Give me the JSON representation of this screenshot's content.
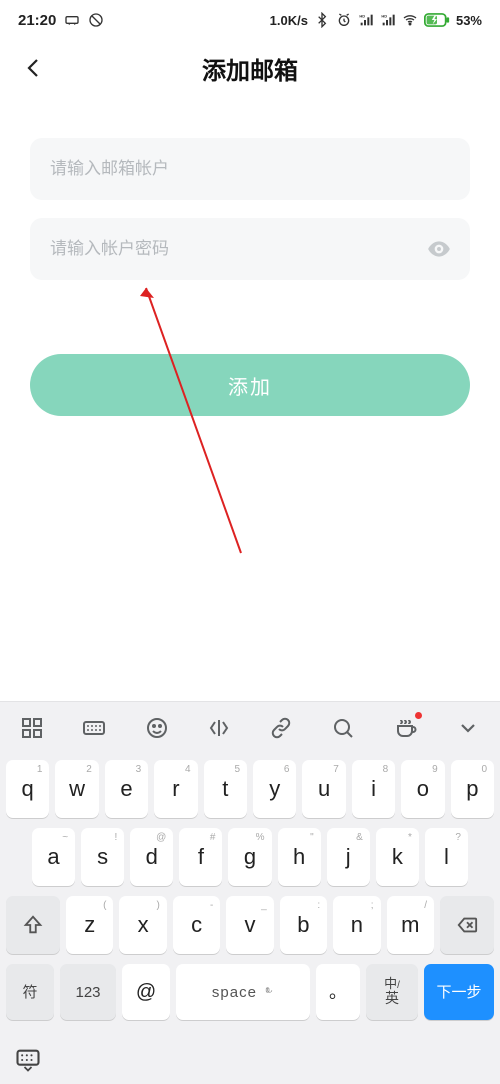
{
  "status": {
    "time": "21:20",
    "net_speed": "1.0K/s",
    "battery_pct": "53%"
  },
  "header": {
    "title": "添加邮箱"
  },
  "form": {
    "email_placeholder": "请输入邮箱帐户",
    "password_placeholder": "请输入帐户密码",
    "submit_label": "添加"
  },
  "keyboard": {
    "row1": [
      {
        "main": "q",
        "sup": "1"
      },
      {
        "main": "w",
        "sup": "2"
      },
      {
        "main": "e",
        "sup": "3"
      },
      {
        "main": "r",
        "sup": "4"
      },
      {
        "main": "t",
        "sup": "5"
      },
      {
        "main": "y",
        "sup": "6"
      },
      {
        "main": "u",
        "sup": "7"
      },
      {
        "main": "i",
        "sup": "8"
      },
      {
        "main": "o",
        "sup": "9"
      },
      {
        "main": "p",
        "sup": "0"
      }
    ],
    "row2": [
      {
        "main": "a",
        "sup": "~"
      },
      {
        "main": "s",
        "sup": "!"
      },
      {
        "main": "d",
        "sup": "@"
      },
      {
        "main": "f",
        "sup": "#"
      },
      {
        "main": "g",
        "sup": "%"
      },
      {
        "main": "h",
        "sup": "\""
      },
      {
        "main": "j",
        "sup": "&"
      },
      {
        "main": "k",
        "sup": "*"
      },
      {
        "main": "l",
        "sup": "?"
      }
    ],
    "row3": [
      {
        "main": "z",
        "sup": "("
      },
      {
        "main": "x",
        "sup": ")"
      },
      {
        "main": "c",
        "sup": "-"
      },
      {
        "main": "v",
        "sup": "_"
      },
      {
        "main": "b",
        "sup": ":"
      },
      {
        "main": "n",
        "sup": ";"
      },
      {
        "main": "m",
        "sup": "/"
      }
    ],
    "row4": {
      "sym": "符",
      "num": "123",
      "at": "@",
      "space": "space",
      "dot": "。",
      "lang": "中/英",
      "next": "下一步"
    }
  }
}
